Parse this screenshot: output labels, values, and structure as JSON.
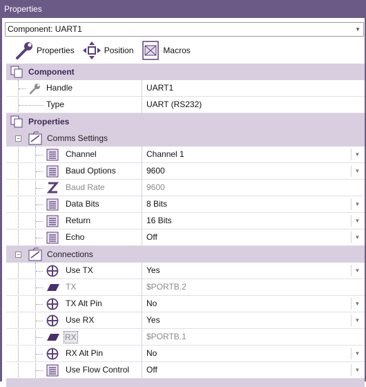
{
  "window": {
    "title": "Properties"
  },
  "component_selector": {
    "value": "Component: UART1"
  },
  "toolbar": {
    "properties": "Properties",
    "position": "Position",
    "macros": "Macros"
  },
  "sections": {
    "component": {
      "title": "Component",
      "handle_label": "Handle",
      "handle_value": "UART1",
      "type_label": "Type",
      "type_value": "UART (RS232)"
    },
    "properties": {
      "title": "Properties"
    },
    "comms": {
      "title": "Comms Settings",
      "channel_label": "Channel",
      "channel_value": "Channel 1",
      "baud_options_label": "Baud Options",
      "baud_options_value": "9600",
      "baud_rate_label": "Baud Rate",
      "baud_rate_value": "9600",
      "data_bits_label": "Data Bits",
      "data_bits_value": "8 Bits",
      "return_label": "Return",
      "return_value": "16 Bits",
      "echo_label": "Echo",
      "echo_value": "Off"
    },
    "connections": {
      "title": "Connections",
      "use_tx_label": "Use TX",
      "use_tx_value": "Yes",
      "tx_label": "TX",
      "tx_value": "$PORTB.2",
      "tx_alt_label": "TX Alt Pin",
      "tx_alt_value": "No",
      "use_rx_label": "Use RX",
      "use_rx_value": "Yes",
      "rx_label": "RX",
      "rx_value": "$PORTB.1",
      "rx_alt_label": "RX Alt Pin",
      "rx_alt_value": "No",
      "flow_label": "Use Flow Control",
      "flow_value": "Off"
    }
  },
  "icons": {
    "dropdown": "chevron-down-icon",
    "collapse": "minus-icon"
  }
}
